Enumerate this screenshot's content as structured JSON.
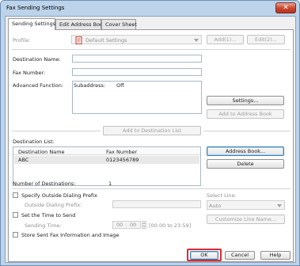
{
  "window": {
    "title": "Fax Sending Settings",
    "close_glyph": "✕"
  },
  "tabs": [
    {
      "label": "Sending Settings",
      "active": true
    },
    {
      "label": "Edit Address Book",
      "active": false
    },
    {
      "label": "Cover Sheet",
      "active": false
    }
  ],
  "profile": {
    "label": "Profile:",
    "value": "Default Settings",
    "add_label": "Add(1)...",
    "edit_label": "Edit(2)...",
    "icon": "profile-document-icon"
  },
  "destination": {
    "name_label": "Destination Name:",
    "name_value": "",
    "fax_label": "Fax Number:",
    "fax_value": "",
    "advanced_label": "Advanced Function:",
    "subaddress_label": "Subaddress:",
    "subaddress_value": "Off",
    "settings_label": "Settings...",
    "add_to_address_book_label": "Add to Address Book",
    "add_to_destination_list_label": "Add to Destination List"
  },
  "destination_list": {
    "label": "Destination List:",
    "columns": [
      "Destination Name",
      "Fax Number"
    ],
    "rows": [
      {
        "name": "ABC",
        "fax": "0123456789"
      }
    ],
    "address_book_label": "Address Book...",
    "delete_label": "Delete",
    "count_label": "Number of Destinations:",
    "count_value": "1"
  },
  "options": {
    "outside_prefix_label": "Specify Outside Dialing Prefix",
    "outside_prefix_field_label": "Outside Dialing Prefix:",
    "outside_prefix_value": "",
    "select_line_label": "Select Line:",
    "select_line_value": "Auto",
    "set_time_label": "Set the Time to Send",
    "sending_time_label": "Sending Time:",
    "sending_time_hour": "00",
    "sending_time_minute": "00",
    "sending_time_sep": ":",
    "sending_time_range": "[00:00 to 23:59]",
    "customize_line_label": "Customize Line Name...",
    "store_sent_label": "Store Sent Fax Information and Image"
  },
  "footer": {
    "ok_label": "OK",
    "cancel_label": "Cancel",
    "help_label": "Help"
  },
  "colors": {
    "title_bar": "#bcd3ea",
    "close_button": "#c8432b",
    "ok_highlight": "#e0282e",
    "row_selected": "#e8e8e8"
  }
}
